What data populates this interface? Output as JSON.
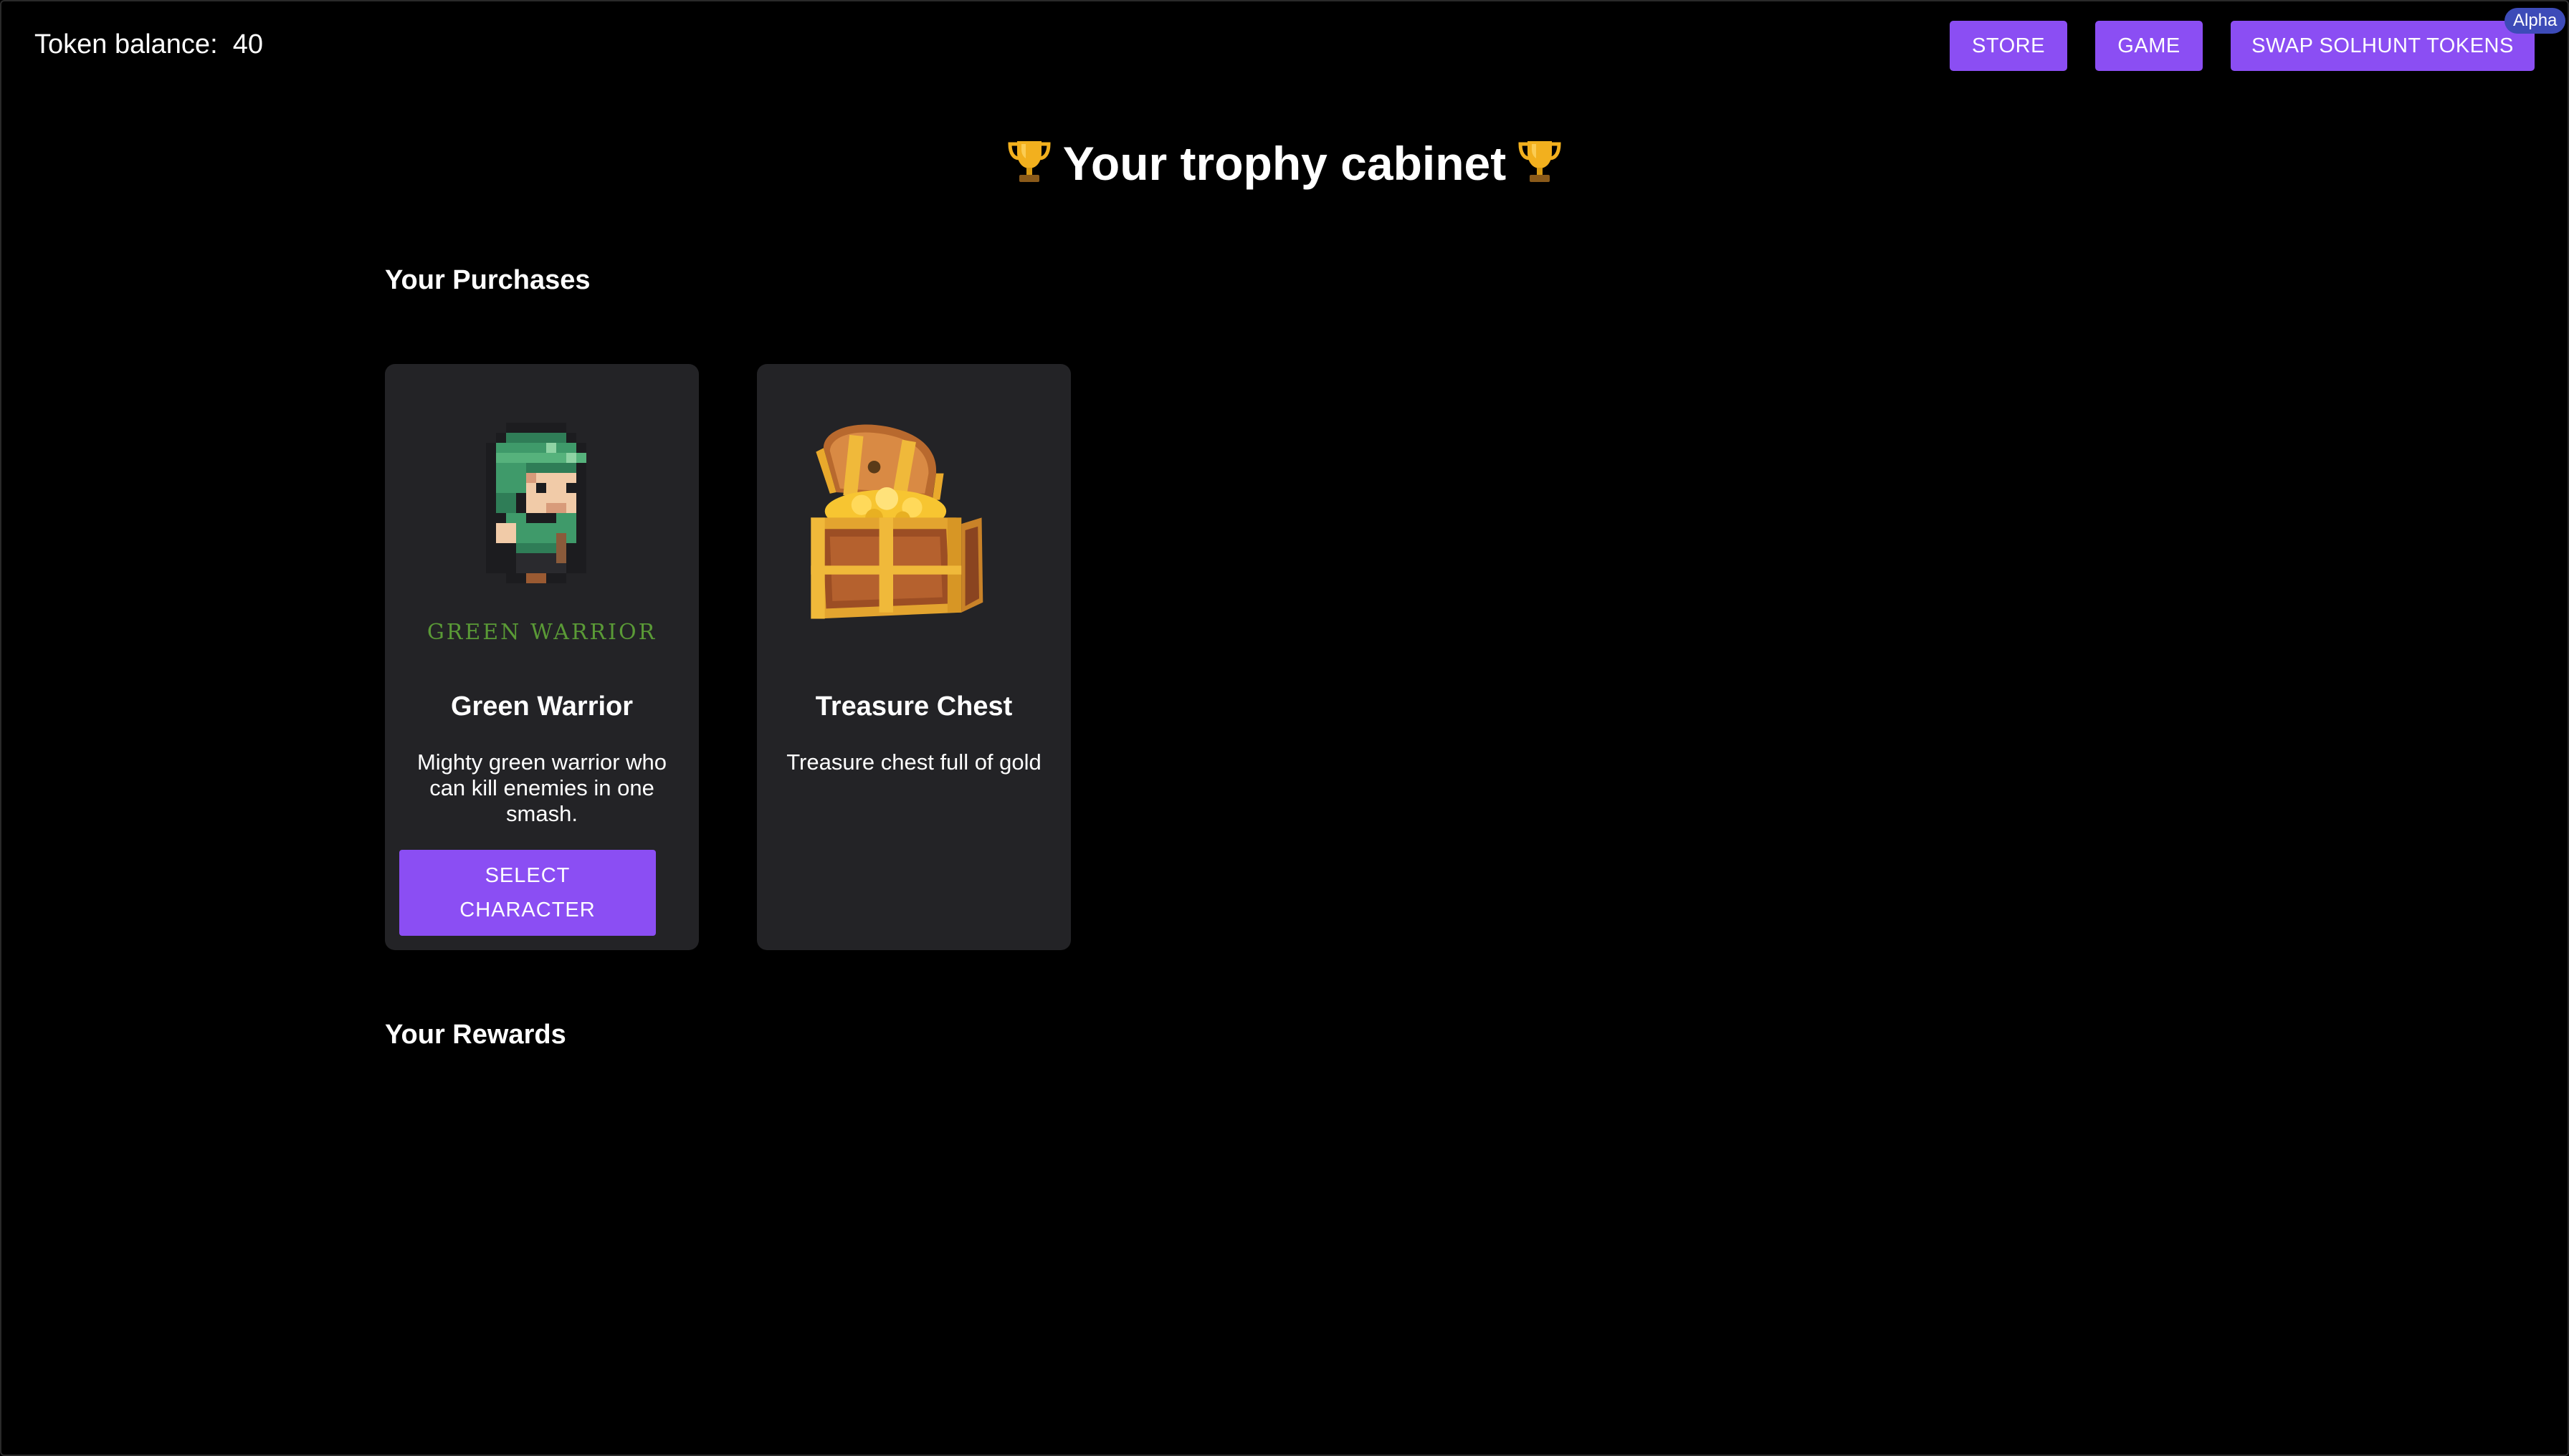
{
  "header": {
    "token_balance_label": "Token balance:",
    "token_balance_value": "40",
    "nav": {
      "store": "STORE",
      "game": "GAME",
      "swap": "SWAP SOLHUNT TOKENS"
    },
    "alpha_badge": "Alpha"
  },
  "page": {
    "title": "Your trophy cabinet"
  },
  "purchases": {
    "heading": "Your Purchases",
    "items": [
      {
        "title": "Green Warrior",
        "image_caption": "GREEN WARRIOR",
        "description": "Mighty green warrior who can kill enemies in one smash.",
        "action_label": "SELECT CHARACTER"
      },
      {
        "title": "Treasure Chest",
        "description": "Treasure chest full of gold"
      }
    ]
  },
  "rewards": {
    "heading": "Your Rewards"
  },
  "colors": {
    "background": "#000000",
    "card": "#232326",
    "accent": "#8b4ef3",
    "badge": "#3d4bb8"
  },
  "icons": {
    "title_decoration": "trophy-icon",
    "card_1_image": "pixel-green-warrior",
    "card_2_image": "treasure-chest"
  }
}
